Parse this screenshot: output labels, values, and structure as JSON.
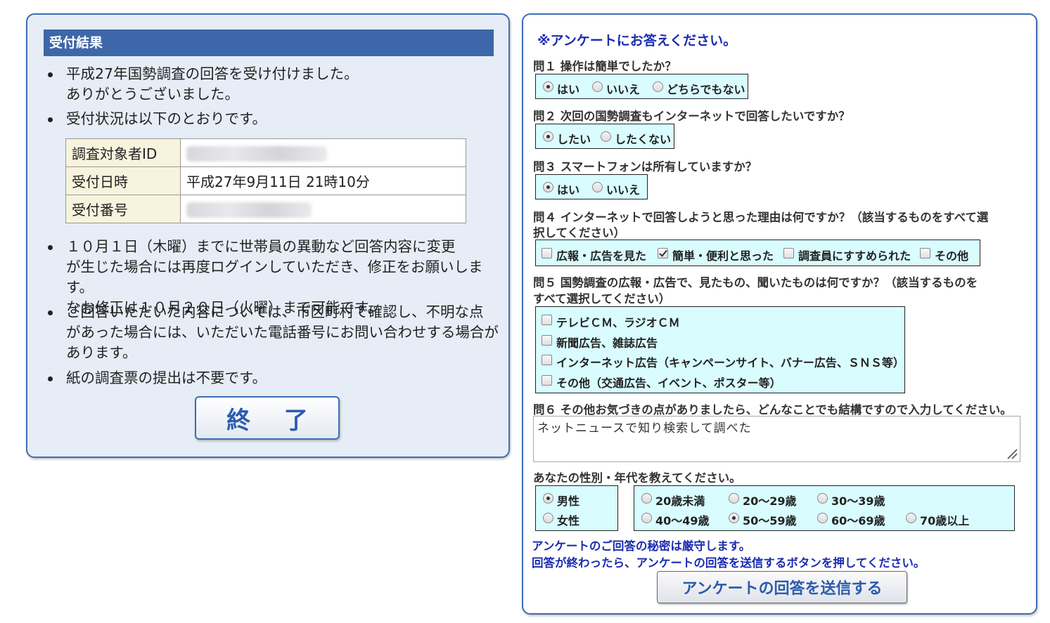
{
  "result": {
    "header": "受付結果",
    "bullet1_line1": "平成27年国勢調査の回答を受け付けました。",
    "bullet1_line2": "ありがとうございました。",
    "bullet2": "受付状況は以下のとおりです。",
    "table": [
      {
        "label": "調査対象者ID",
        "value": ""
      },
      {
        "label": "受付日時",
        "value": "平成27年9月11日 21時10分"
      },
      {
        "label": "受付番号",
        "value": ""
      }
    ],
    "bullet3_line1": "１０月１日（木曜）までに世帯員の異動など回答内容に変更",
    "bullet3_line2": "が生じた場合には再度ログインしていただき、修正をお願いします。",
    "bullet3_line3": "なお修正は１０月２０日（火曜）まで可能です。",
    "bullet4_line1": "ご回答いただいた内容については、市区町村で確認し、不明な点",
    "bullet4_line2": "があった場合には、いただいた電話番号にお問い合わせする場合が",
    "bullet4_line3": "あります。",
    "bullet5": "紙の調査票の提出は不要です。",
    "finish_label": "終 了"
  },
  "survey": {
    "title": "※アンケートにお答えください。",
    "q1": {
      "text": "問１ 操作は簡単でしたか？",
      "options": [
        "はい",
        "いいえ",
        "どちらでもない"
      ],
      "selected": 0
    },
    "q2": {
      "text": "問２ 次回の国勢調査もインターネットで回答したいですか？",
      "options": [
        "したい",
        "したくない"
      ],
      "selected": 0
    },
    "q3": {
      "text": "問３ スマートフォンは所有していますか？",
      "options": [
        "はい",
        "いいえ"
      ],
      "selected": 0
    },
    "q4": {
      "text_line1": "問４ インターネットで回答しようと思った理由は何ですか？（該当するものをすべて選",
      "text_line2": "択してください）",
      "options": [
        "広報・広告を見た",
        "簡単・便利と思った",
        "調査員にすすめられた",
        "その他"
      ],
      "checked": [
        1
      ]
    },
    "q5": {
      "text_line1": "問５ 国勢調査の広報・広告で、見たもの、聞いたものは何ですか？（該当するものを",
      "text_line2": "すべて選択してください）",
      "options": [
        "テレビＣＭ、ラジオＣＭ",
        "新聞広告、雑誌広告",
        "インターネット広告（キャンペーンサイト、バナー広告、ＳＮＳ等）",
        "その他（交通広告、イベント、ポスター等）"
      ],
      "checked": []
    },
    "q6": {
      "text": "問６ その他お気づきの点がありましたら、どんなことでも結構ですので入力してください。",
      "value": "ネットニュースで知り検索して調べた"
    },
    "demographics": {
      "text": "あなたの性別・年代を教えてください。",
      "gender": [
        "男性",
        "女性"
      ],
      "gender_selected": 0,
      "ages": [
        "20歳未満",
        "20～29歳",
        "30～39歳",
        "40～49歳",
        "50～59歳",
        "60～69歳",
        "70歳以上"
      ],
      "age_selected": 4
    },
    "note_line1": "アンケートのご回答の秘密は厳守します。",
    "note_line2": "回答が終わったら、アンケートの回答を送信するボタンを押してください。",
    "send_label": "アンケートの回答を送信する"
  }
}
